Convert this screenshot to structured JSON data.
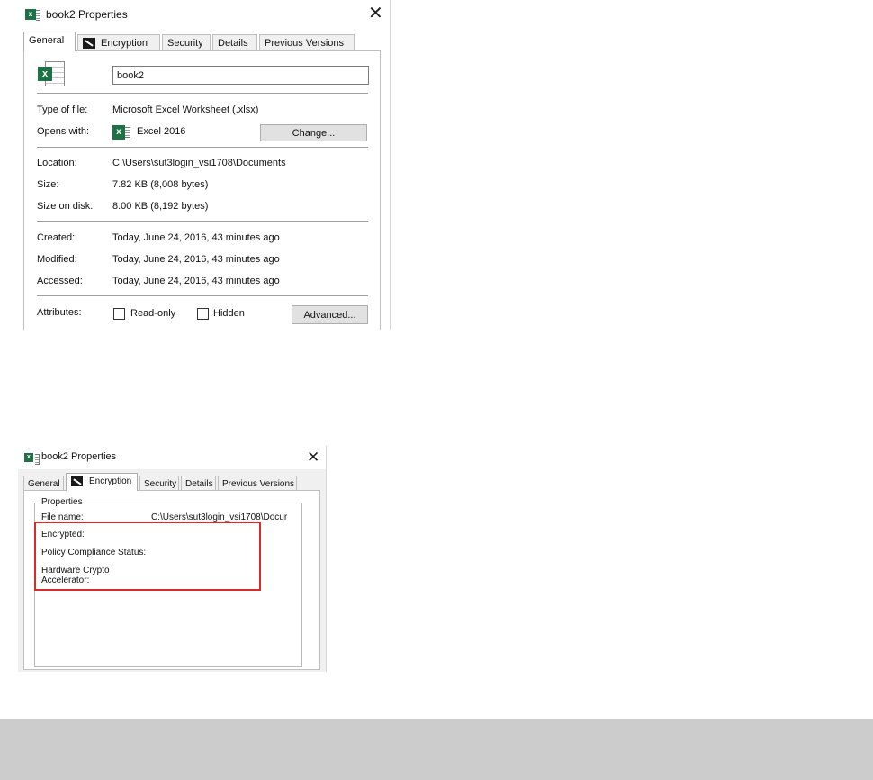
{
  "dialog1": {
    "title": "book2 Properties",
    "close_glyph": "✕",
    "tabs": [
      "General",
      "Encryption",
      "Security",
      "Details",
      "Previous Versions"
    ],
    "active_tab": "General",
    "file_name_value": "book2",
    "type_of_file_label": "Type of file:",
    "type_of_file_value": "Microsoft Excel Worksheet (.xlsx)",
    "opens_with_label": "Opens with:",
    "opens_with_value": "Excel 2016",
    "change_button": "Change...",
    "location_label": "Location:",
    "location_value": "C:\\Users\\sut3login_vsi1708\\Documents",
    "size_label": "Size:",
    "size_value": "7.82 KB (8,008 bytes)",
    "size_on_disk_label": "Size on disk:",
    "size_on_disk_value": "8.00 KB (8,192 bytes)",
    "created_label": "Created:",
    "created_value": "Today, June 24, 2016, 43 minutes ago",
    "modified_label": "Modified:",
    "modified_value": "Today, June 24, 2016, 43 minutes ago",
    "accessed_label": "Accessed:",
    "accessed_value": "Today, June 24, 2016, 43 minutes ago",
    "attributes_label": "Attributes:",
    "readonly_label": "Read-only",
    "hidden_label": "Hidden",
    "advanced_button": "Advanced..."
  },
  "dialog2": {
    "title": "book2 Properties",
    "close_glyph": "✕",
    "tabs": [
      "General",
      "Encryption",
      "Security",
      "Details",
      "Previous Versions"
    ],
    "active_tab": "Encryption",
    "group_title": "Properties",
    "file_name_label": "File name:",
    "file_name_value": "C:\\Users\\sut3login_vsi1708\\Docur",
    "encrypted_label": "Encrypted:",
    "policy_label": "Policy Compliance Status:",
    "hardware_label_line1": "Hardware Crypto",
    "hardware_label_line2": "Accelerator:"
  },
  "colors": {
    "excel_green": "#1e7145",
    "highlight_red": "#d62c2c",
    "band_gray": "#cccccc"
  },
  "icons": [
    "excel-icon",
    "encryption-icon",
    "close-icon"
  ]
}
